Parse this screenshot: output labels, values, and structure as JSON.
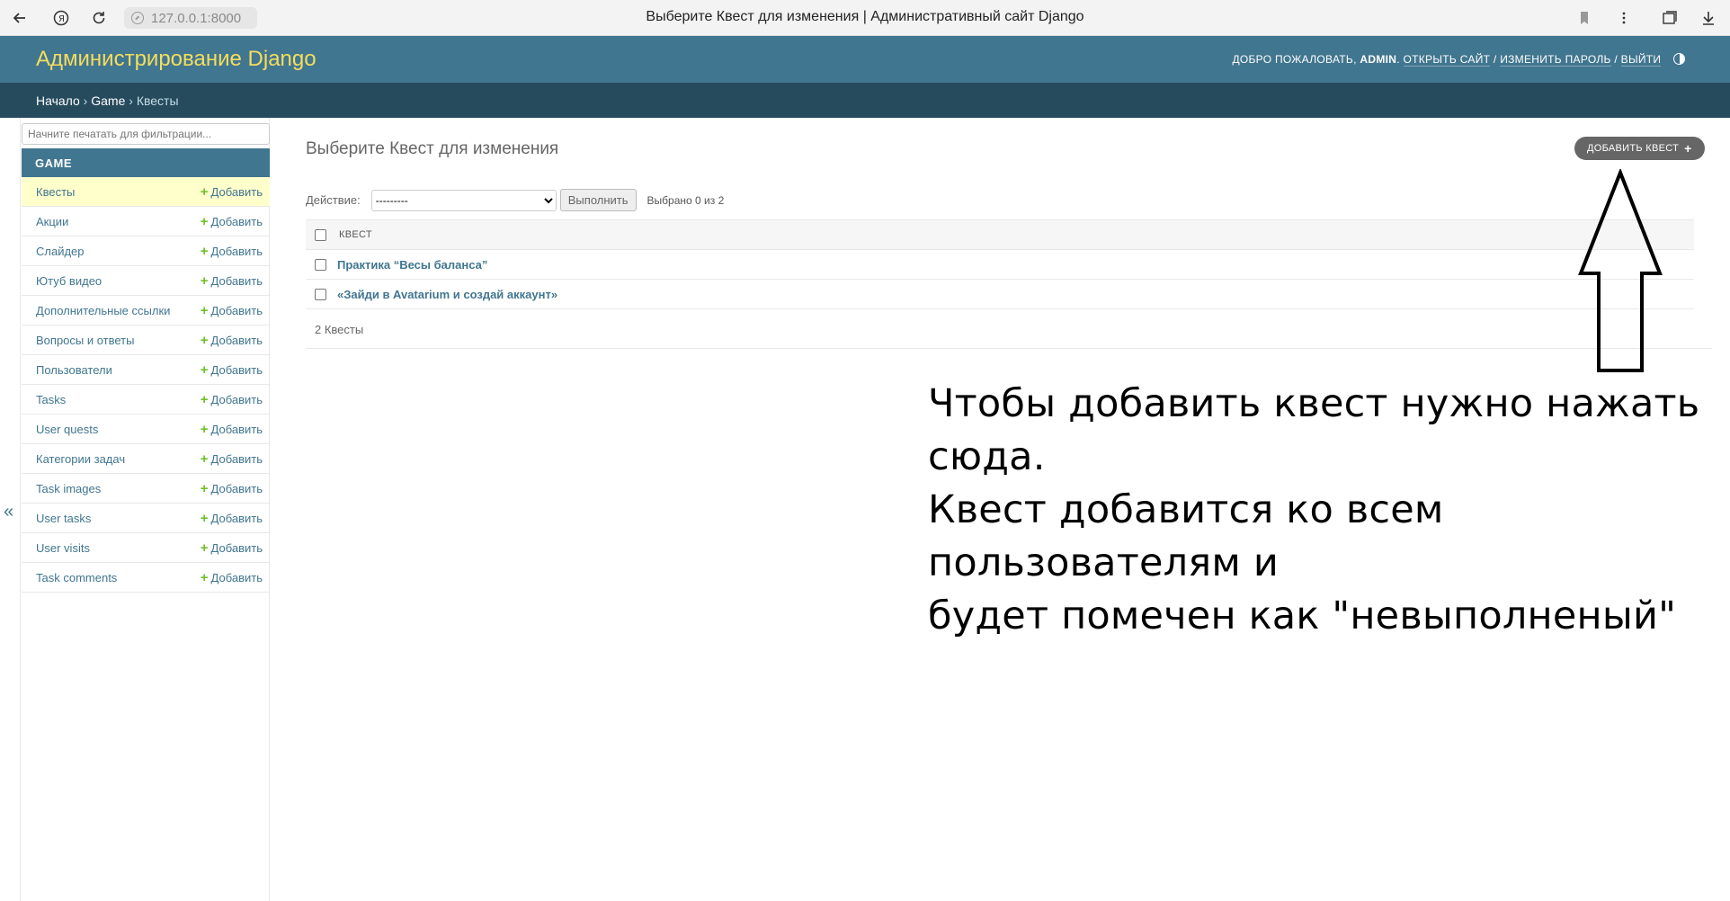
{
  "browser": {
    "url": "127.0.0.1:8000",
    "tab_title": "Выберите Квест для изменения | Административный сайт Django"
  },
  "header": {
    "branding": "Администрирование Django",
    "welcome": "Добро пожаловать,",
    "username": "admin",
    "view_site": "Открыть сайт",
    "change_password": "Изменить пароль",
    "logout": "Выйти"
  },
  "breadcrumbs": {
    "home": "Начало",
    "app": "Game",
    "current": "Квесты",
    "separator": "›"
  },
  "sidebar": {
    "filter_placeholder": "Начните печатать для фильтрации...",
    "app_caption": "Game",
    "add_label": "Добавить",
    "items": [
      {
        "label": "Квесты"
      },
      {
        "label": "Акции"
      },
      {
        "label": "Слайдер"
      },
      {
        "label": "Ютуб видео"
      },
      {
        "label": "Дополнительные ссылки"
      },
      {
        "label": "Вопросы и ответы"
      },
      {
        "label": "Пользователи"
      },
      {
        "label": "Tasks"
      },
      {
        "label": "User quests"
      },
      {
        "label": "Категории задач"
      },
      {
        "label": "Task images"
      },
      {
        "label": "User tasks"
      },
      {
        "label": "User visits"
      },
      {
        "label": "Task comments"
      }
    ],
    "collapse_symbol": "«"
  },
  "main": {
    "title": "Выберите Квест для изменения",
    "add_button": "Добавить Квест",
    "action_label": "Действие:",
    "action_selected": "---------",
    "run_button": "Выполнить",
    "selected_count": "Выбрано 0 из 2",
    "column_header": "Квест",
    "rows": [
      {
        "label": "Практика “Весы баланса”"
      },
      {
        "label": "«Зайди в Avatarium и создай аккаунт»"
      }
    ],
    "paginator": "2 Квесты"
  },
  "annotation": {
    "line1": "Чтобы добавить квест нужно нажать сюда.",
    "line2": "Квест добавится ко всем пользователям и",
    "line3": "будет помечен как \"невыполненый\""
  },
  "colors": {
    "header": "#417690",
    "breadcrumbs": "#264b5d",
    "branding": "#f5dd5d",
    "link": "#417690",
    "add_plus": "#70bf2b",
    "current_row": "#ffffcc"
  }
}
